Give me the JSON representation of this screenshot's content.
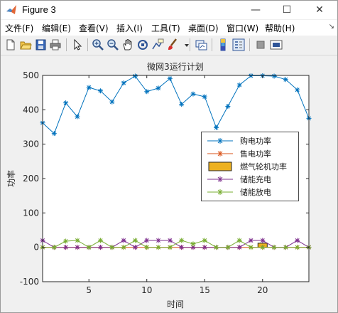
{
  "window": {
    "title": "Figure 3",
    "minimize_glyph": "—",
    "maximize_glyph": "☐",
    "close_glyph": "✕"
  },
  "menu": {
    "items": [
      "文件(F)",
      "编辑(E)",
      "查看(V)",
      "插入(I)",
      "工具(T)",
      "桌面(D)",
      "窗口(W)",
      "帮助(H)"
    ],
    "overflow_glyph": "↘"
  },
  "toolbar": {
    "icons": [
      "new-figure-icon",
      "open-file-icon",
      "save-icon",
      "print-icon",
      "pointer-icon",
      "zoom-in-icon",
      "zoom-out-icon",
      "pan-hand-icon",
      "rotate-3d-icon",
      "data-cursor-icon",
      "brush-icon",
      "brush-dropdown-icon",
      "link-plot-icon",
      "insert-colorbar-icon",
      "insert-legend-icon",
      "hide-plot-tools-icon",
      "show-plot-tools-icon"
    ]
  },
  "colors": {
    "buy": "#0072bd",
    "sell": "#d95319",
    "turbine": "#edb120",
    "charge": "#7e2f8e",
    "discharge": "#77ac30"
  },
  "chart_data": {
    "type": "line",
    "title": "微网3运行计划",
    "xlabel": "时间",
    "ylabel": "功率",
    "xlim": [
      1,
      24
    ],
    "ylim": [
      -100,
      500
    ],
    "xticks": [
      5,
      10,
      15,
      20
    ],
    "yticks": [
      -100,
      0,
      100,
      200,
      300,
      400,
      500
    ],
    "grid": false,
    "legend_position": "right",
    "x": [
      1,
      2,
      3,
      4,
      5,
      6,
      7,
      8,
      9,
      10,
      11,
      12,
      13,
      14,
      15,
      16,
      17,
      18,
      19,
      20,
      21,
      22,
      23,
      24
    ],
    "series": [
      {
        "name": "购电功率",
        "style": "line-star",
        "values": [
          362,
          331,
          420,
          380,
          465,
          455,
          423,
          478,
          498,
          453,
          463,
          491,
          416,
          446,
          438,
          348,
          410,
          472,
          499,
          499,
          498,
          488,
          458,
          375
        ]
      },
      {
        "name": "售电功率",
        "style": "line-star",
        "values": [
          0,
          0,
          0,
          0,
          0,
          0,
          0,
          0,
          0,
          0,
          0,
          0,
          0,
          0,
          0,
          0,
          0,
          0,
          0,
          0,
          0,
          0,
          0,
          0
        ]
      },
      {
        "name": "燃气轮机功率",
        "style": "bar",
        "values": [
          0,
          0,
          0,
          0,
          0,
          0,
          0,
          0,
          0,
          0,
          0,
          0,
          0,
          0,
          0,
          0,
          0,
          0,
          0,
          12,
          0,
          0,
          0,
          0
        ]
      },
      {
        "name": "储能充电",
        "style": "line-star",
        "values": [
          20,
          0,
          0,
          0,
          0,
          0,
          0,
          20,
          0,
          20,
          20,
          20,
          0,
          0,
          0,
          0,
          0,
          0,
          20,
          20,
          0,
          0,
          20,
          0
        ]
      },
      {
        "name": "储能放电",
        "style": "line-star",
        "values": [
          0,
          0,
          18,
          20,
          0,
          20,
          0,
          0,
          20,
          0,
          0,
          0,
          20,
          10,
          20,
          0,
          0,
          20,
          0,
          0,
          0,
          0,
          0,
          0
        ]
      }
    ]
  }
}
